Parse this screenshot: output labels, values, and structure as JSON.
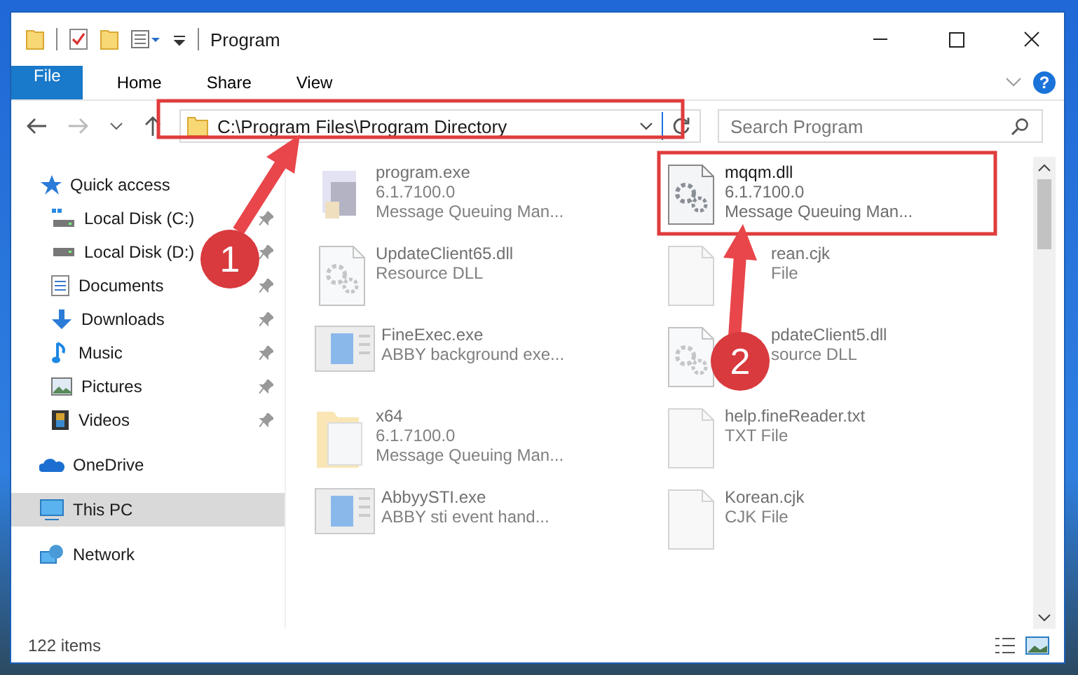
{
  "window": {
    "title": "Program"
  },
  "ribbon_tabs": [
    {
      "label": "File",
      "kind": "file"
    },
    {
      "label": "Home",
      "kind": "tab"
    },
    {
      "label": "Share",
      "kind": "tab"
    },
    {
      "label": "View",
      "kind": "tab"
    }
  ],
  "help_label": "?",
  "address_bar": {
    "value": "C:\\Program Files\\Program Directory"
  },
  "search": {
    "placeholder": "Search Program"
  },
  "sidebar": {
    "items": [
      {
        "label": "Quick access",
        "selected": false,
        "children": [
          {
            "label": "Local Disk (C:)",
            "pinned": true,
            "selected": false
          },
          {
            "label": "Local Disk (D:)",
            "pinned": true,
            "selected": false
          },
          {
            "label": "Documents",
            "pinned": true,
            "selected": false
          },
          {
            "label": "Downloads",
            "pinned": true,
            "selected": false
          },
          {
            "label": "Music",
            "pinned": true,
            "selected": false
          },
          {
            "label": "Pictures",
            "pinned": true,
            "selected": false
          },
          {
            "label": "Videos",
            "pinned": true,
            "selected": false
          }
        ]
      },
      {
        "label": "OneDrive",
        "selected": false
      },
      {
        "label": "This PC",
        "selected": true
      },
      {
        "label": "Network",
        "selected": false
      }
    ]
  },
  "files": [
    {
      "name": "program.exe",
      "details": [
        "6.1.7100.0",
        "Message Queuing Man..."
      ],
      "blurred": true,
      "covered": false
    },
    {
      "name": "mqqm.dll",
      "details": [
        "6.1.7100.0",
        "Message Queuing Man..."
      ],
      "blurred": false,
      "covered": false
    },
    {
      "name": "UpdateClient65.dll",
      "details": [
        "Resource DLL"
      ],
      "blurred": true,
      "covered": false
    },
    {
      "name": "rean.cjk",
      "details": [
        "File"
      ],
      "blurred": true,
      "covered": true
    },
    {
      "name": "FineExec.exe",
      "details": [
        "ABBY background exe..."
      ],
      "blurred": true,
      "covered": false
    },
    {
      "name": "pdateClient5.dll",
      "details": [
        "source DLL"
      ],
      "blurred": true,
      "covered": true
    },
    {
      "name": "x64",
      "details": [
        "6.1.7100.0",
        "Message Queuing Man..."
      ],
      "blurred": true,
      "covered": false
    },
    {
      "name": "help.fineReader.txt",
      "details": [
        "TXT File"
      ],
      "blurred": true,
      "covered": false
    },
    {
      "name": "AbbyySTI.exe",
      "details": [
        "ABBY sti event hand..."
      ],
      "blurred": true,
      "covered": false
    },
    {
      "name": "Korean.cjk",
      "details": [
        "CJK File"
      ],
      "blurred": true,
      "covered": false
    }
  ],
  "status_bar": {
    "item_count": "122 items"
  },
  "annotations": [
    {
      "label": "1"
    },
    {
      "label": "2"
    }
  ]
}
